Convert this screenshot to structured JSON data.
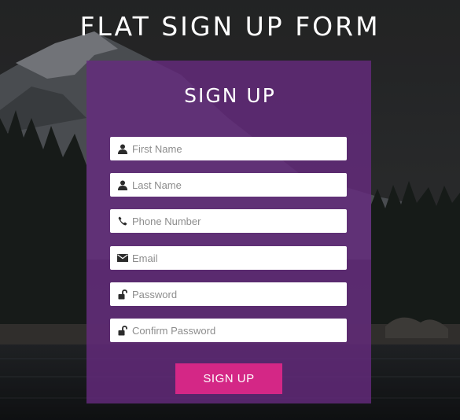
{
  "page": {
    "title": "FLAT SIGN UP FORM"
  },
  "form": {
    "title": "SIGN UP",
    "fields": [
      {
        "placeholder": "First Name",
        "icon": "user-icon"
      },
      {
        "placeholder": "Last Name",
        "icon": "user-icon"
      },
      {
        "placeholder": "Phone Number",
        "icon": "phone-icon"
      },
      {
        "placeholder": "Email",
        "icon": "envelope-icon"
      },
      {
        "placeholder": "Password",
        "icon": "unlock-icon"
      },
      {
        "placeholder": "Confirm Password",
        "icon": "unlock-icon"
      }
    ],
    "submit_label": "SIGN UP"
  },
  "colors": {
    "panel": "#662a80",
    "button": "#d42786",
    "text": "#ffffff"
  }
}
